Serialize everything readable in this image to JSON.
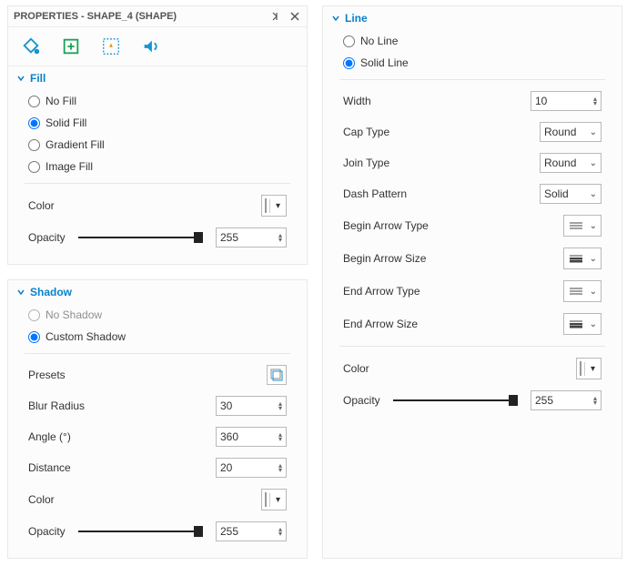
{
  "header": {
    "title": "PROPERTIES - SHAPE_4 (SHAPE)"
  },
  "fill": {
    "title": "Fill",
    "options": {
      "none": "No Fill",
      "solid": "Solid Fill",
      "gradient": "Gradient Fill",
      "image": "Image Fill"
    },
    "selected": "solid",
    "color_label": "Color",
    "color": "#ffe03a",
    "opacity_label": "Opacity",
    "opacity": "255"
  },
  "shadow": {
    "title": "Shadow",
    "options": {
      "none": "No Shadow",
      "custom": "Custom Shadow"
    },
    "selected": "custom",
    "presets_label": "Presets",
    "blur_label": "Blur Radius",
    "blur": "30",
    "angle_label": "Angle (°)",
    "angle": "360",
    "distance_label": "Distance",
    "distance": "20",
    "color_label": "Color",
    "color": "#ffe03a",
    "opacity_label": "Opacity",
    "opacity": "255"
  },
  "line": {
    "title": "Line",
    "options": {
      "none": "No Line",
      "solid": "Solid Line"
    },
    "selected": "solid",
    "width_label": "Width",
    "width": "10",
    "cap_label": "Cap Type",
    "cap": "Round",
    "join_label": "Join Type",
    "join": "Round",
    "dash_label": "Dash Pattern",
    "dash": "Solid",
    "begin_arrow_type_label": "Begin Arrow Type",
    "begin_arrow_size_label": "Begin Arrow Size",
    "end_arrow_type_label": "End Arrow Type",
    "end_arrow_size_label": "End Arrow Size",
    "color_label": "Color",
    "color": "#8de84a",
    "opacity_label": "Opacity",
    "opacity": "255"
  }
}
